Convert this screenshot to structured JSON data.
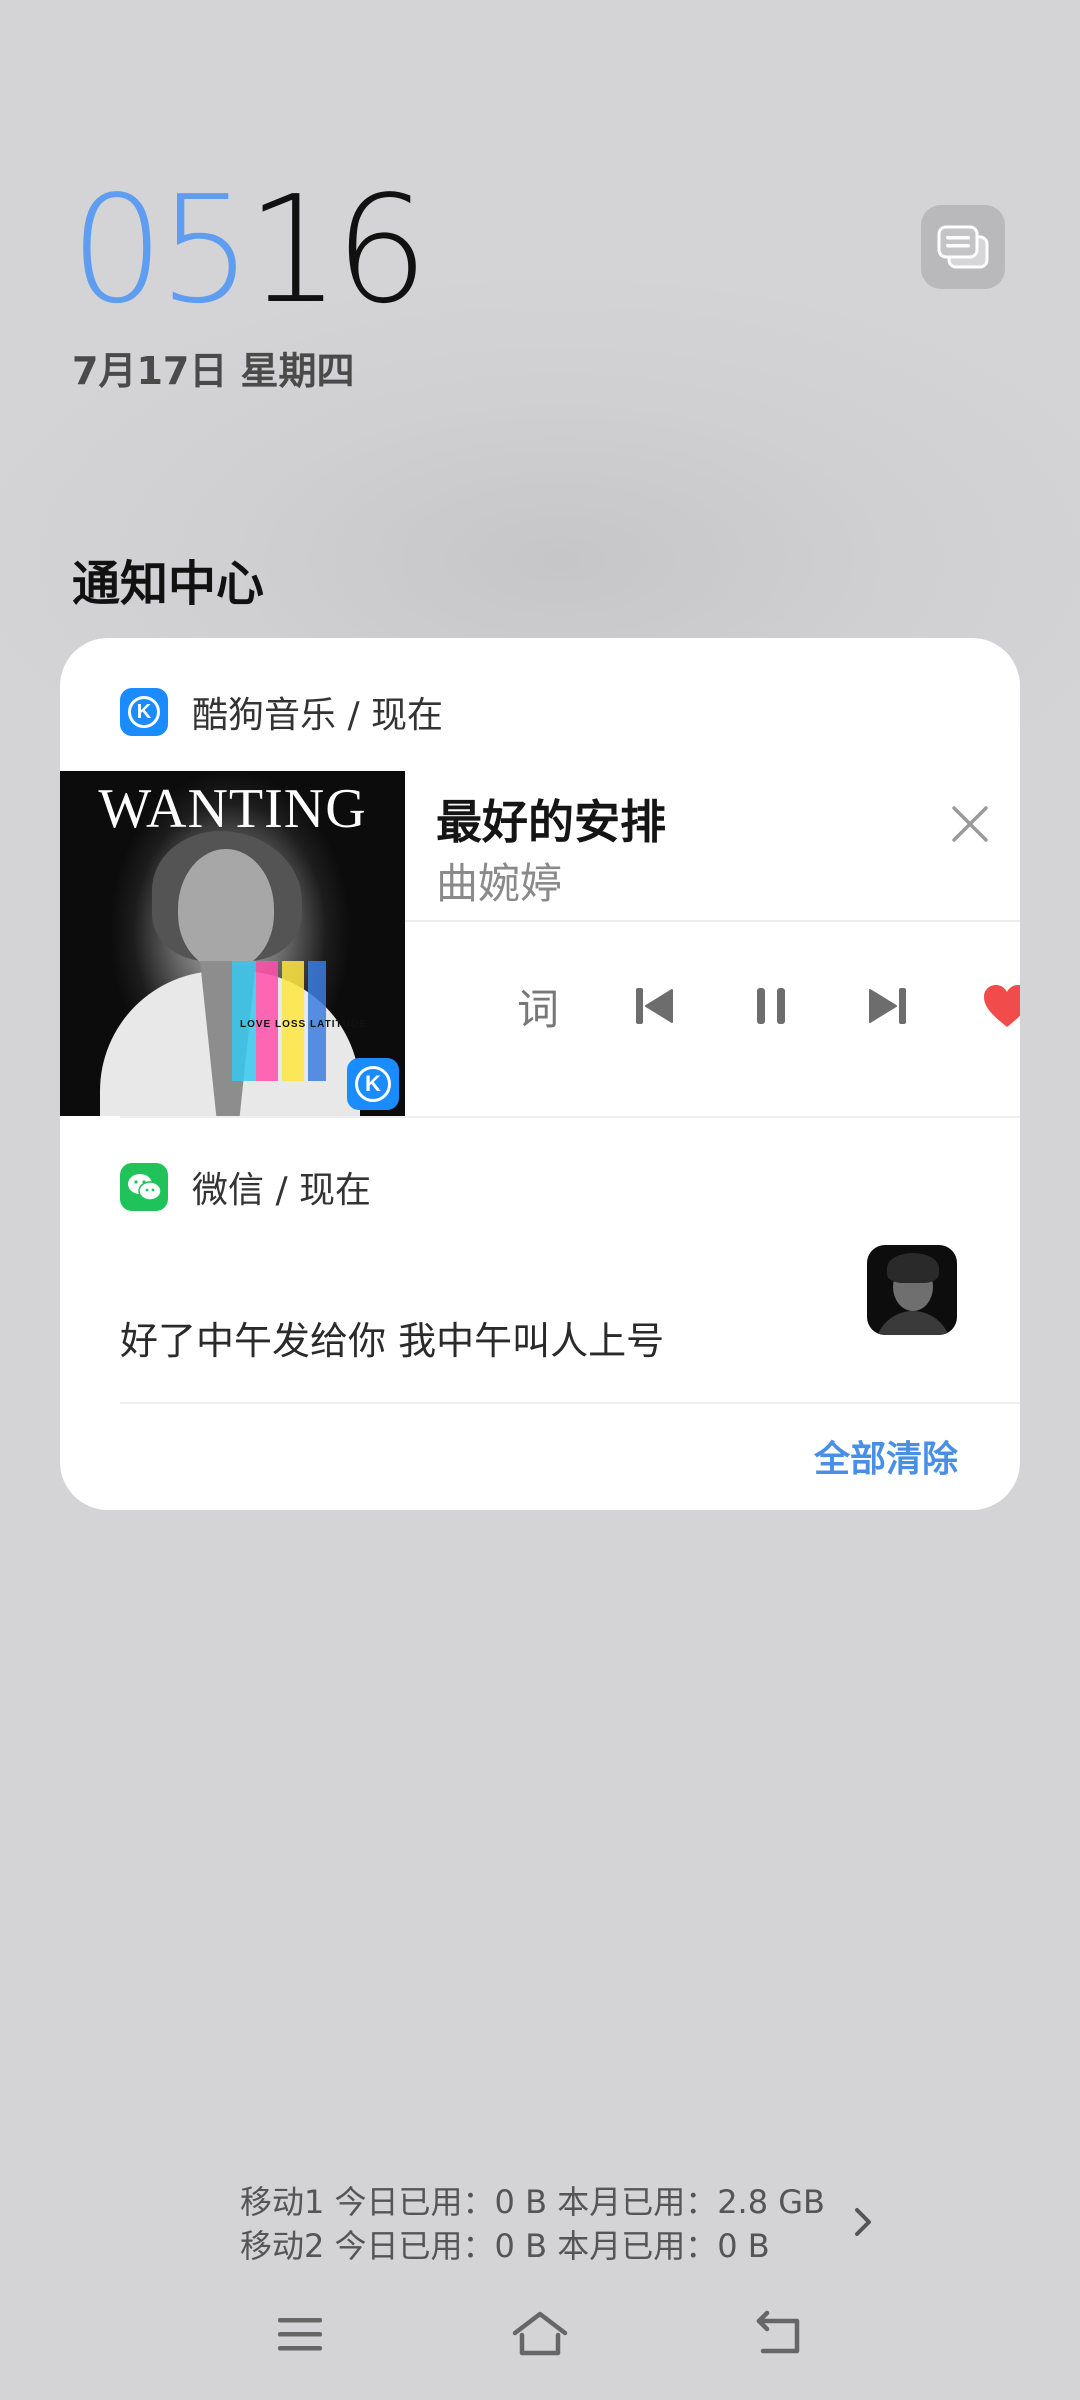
{
  "clock": {
    "hour": "05",
    "minute": "16"
  },
  "date": "7月17日 星期四",
  "section_title": "通知中心",
  "colors": {
    "clock_hour": "#5f9df0",
    "accent": "#4a8fe6",
    "kugou_blue": "#1a8cff",
    "wechat_green": "#1fc35a",
    "like_red": "#f24b4b"
  },
  "notifications": {
    "music": {
      "app_label": "酷狗音乐 / 现在",
      "app_icon": "kugou-icon",
      "album": {
        "title": "WANTING",
        "subtitle": "LOVE LOSS LATITUDE",
        "badge": "K"
      },
      "song_title": "最好的安排",
      "artist": "曲婉婷",
      "controls": {
        "lyrics_label": "词",
        "icons": [
          "close-icon",
          "previous-icon",
          "pause-icon",
          "next-icon",
          "heart-icon"
        ]
      }
    },
    "wechat": {
      "app_label": "微信 / 现在",
      "app_icon": "wechat-icon",
      "message": "好了中午发给你 我中午叫人上号"
    },
    "clear_all_label": "全部清除"
  },
  "data_usage": {
    "line1": "移动1 今日已用：0 B 本月已用：2.8 GB",
    "line2": "移动2 今日已用：0 B 本月已用：0 B"
  },
  "nav": {
    "icons": [
      "menu-icon",
      "home-icon",
      "back-icon"
    ]
  }
}
